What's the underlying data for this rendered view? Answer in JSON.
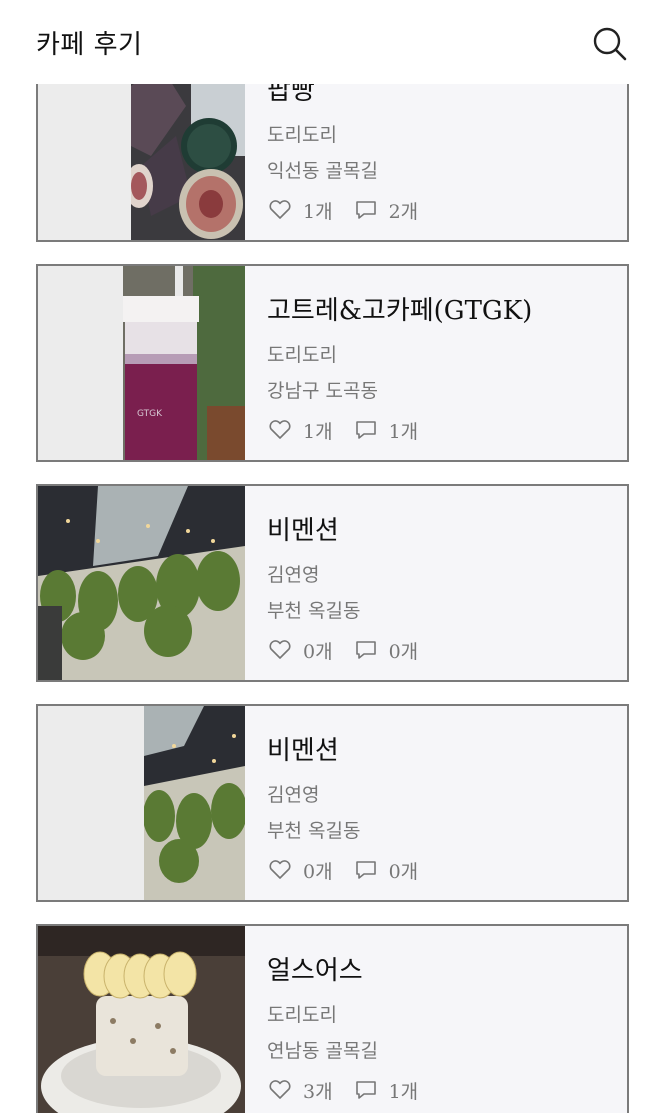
{
  "header": {
    "title": "카페 후기",
    "search_icon": "search-icon"
  },
  "posts": [
    {
      "title": "팝빵",
      "author": "도리도리",
      "location": "익선동 골목길",
      "likes": "1개",
      "comments": "2개",
      "image": "fig-cake-photo"
    },
    {
      "title": "고트레&고카페(GTGK)",
      "author": "도리도리",
      "location": "강남구 도곡동",
      "likes": "1개",
      "comments": "1개",
      "image": "berry-drink-cup-photo"
    },
    {
      "title": "비멘션",
      "author": "김연영",
      "location": "부천 옥길동",
      "likes": "0개",
      "comments": "0개",
      "image": "cafe-interior-plants-photo"
    },
    {
      "title": "비멘션",
      "author": "김연영",
      "location": "부천 옥길동",
      "likes": "0개",
      "comments": "0개",
      "image": "cafe-interior-plants-photo"
    },
    {
      "title": "얼스어스",
      "author": "도리도리",
      "location": "연남동 골목길",
      "likes": "3개",
      "comments": "1개",
      "image": "banana-cake-photo"
    }
  ],
  "icons": {
    "like": "heart-outline-icon",
    "comment": "speech-bubble-icon"
  },
  "colors": {
    "card_bg": "#f6f6f9",
    "card_border": "#7b7b7b",
    "muted_text": "#777777"
  }
}
